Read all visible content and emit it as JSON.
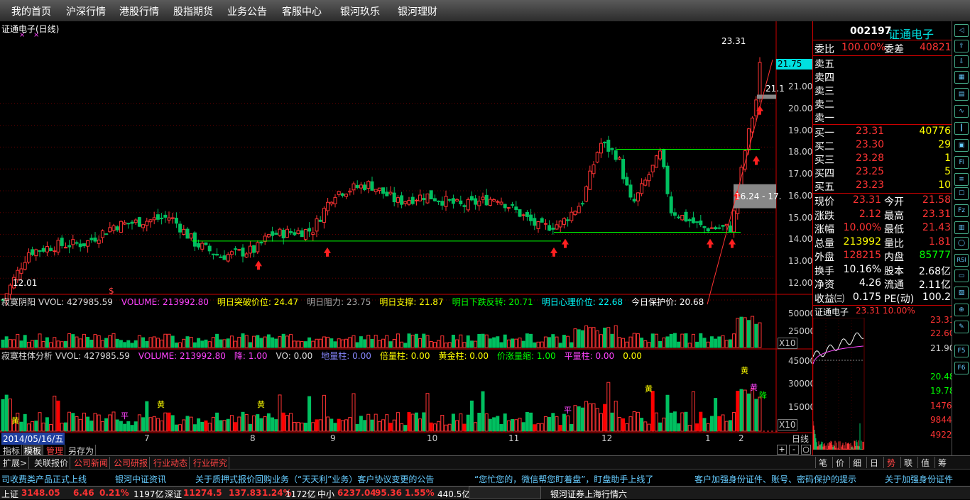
{
  "menu": [
    "我的首页",
    "沪深行情",
    "港股行情",
    "股指期货",
    "业务公告",
    "客服中心",
    "银河玖乐",
    "银河理财"
  ],
  "chart": {
    "title": "证通电子(日线)",
    "max_label": "23.31",
    "min_label": "12.01",
    "price_tag": "21.75",
    "edge_label": "21.1",
    "box_label": "16.24 - 17.",
    "price_ticks": [
      "21.00",
      "20.00",
      "19.00",
      "18.00",
      "17.00",
      "16.00",
      "15.00",
      "14.00",
      "13.00",
      "12.00"
    ],
    "date_box": "2014/05/16/五",
    "months": [
      "7",
      "8",
      "9",
      "10",
      "11",
      "12",
      "1",
      "2"
    ],
    "vol_ticks": [
      "50000",
      "25000",
      "X10"
    ],
    "vol2_ticks": [
      "45000",
      "30000",
      "15000",
      "X10"
    ],
    "money_mark": "$",
    "ind1": [
      {
        "t": "寂寞阴阳 VVOL: 427985.59",
        "c": "#dddddd"
      },
      {
        "t": "VOLUME: 213992.80",
        "c": "#ff44ff"
      },
      {
        "t": "明日突破价位: 24.47",
        "c": "#ffff00"
      },
      {
        "t": "明日阻力: 23.75",
        "c": "#aaaaaa"
      },
      {
        "t": "明日支撑: 21.87",
        "c": "#ffff00"
      },
      {
        "t": "明日下跌反转: 20.71",
        "c": "#00ff00"
      },
      {
        "t": "明日心理价位: 22.68",
        "c": "#00ffff"
      },
      {
        "t": "今日保护价: 20.68",
        "c": "#ffffff"
      }
    ],
    "ind2": [
      {
        "t": "寂寞柱体分析 VVOL: 427985.59",
        "c": "#dddddd"
      },
      {
        "t": "VOLUME: 213992.80",
        "c": "#ff44ff"
      },
      {
        "t": "降: 1.00",
        "c": "#ff44ff"
      },
      {
        "t": "VO: 0.00",
        "c": "#dddddd"
      },
      {
        "t": "地量柱: 0.00",
        "c": "#8888ff"
      },
      {
        "t": "倍量柱: 0.00",
        "c": "#ffff00"
      },
      {
        "t": "黄金柱: 0.00",
        "c": "#ffff00"
      },
      {
        "t": "价涨量缩: 1.00",
        "c": "#00ff00"
      },
      {
        "t": "平量柱: 0.00",
        "c": "#ff44ff"
      },
      {
        "t": "0.00",
        "c": "#ffff00"
      }
    ],
    "vol_labels": [
      "黄",
      "平",
      "黄",
      "黄",
      "平",
      "黄",
      "黄",
      "黄",
      "降"
    ]
  },
  "subtabs": [
    "指标",
    "模板",
    "管理",
    "另存为"
  ],
  "extabs": [
    "扩展>",
    "关联报价",
    "公司新闻",
    "公司研报",
    "行业动态",
    "行业研究"
  ],
  "quote": {
    "code": "002197",
    "name": "证通电子",
    "wb_label": "委比",
    "wb": "100.00%",
    "wc_label": "委差",
    "wc": "40821",
    "sell": [
      "卖五",
      "卖四",
      "卖三",
      "卖二",
      "卖一"
    ],
    "buy": [
      {
        "l": "买一",
        "p": "23.31",
        "v": "40776"
      },
      {
        "l": "买二",
        "p": "23.30",
        "v": "29"
      },
      {
        "l": "买三",
        "p": "23.28",
        "v": "1"
      },
      {
        "l": "买四",
        "p": "23.25",
        "v": "5"
      },
      {
        "l": "买五",
        "p": "23.23",
        "v": "10"
      }
    ],
    "stats": [
      {
        "l1": "现价",
        "v1": "23.31",
        "c1": "#ff3333",
        "l2": "今开",
        "v2": "21.58",
        "c2": "#ff3333"
      },
      {
        "l1": "涨跌",
        "v1": "2.12",
        "c1": "#ff3333",
        "l2": "最高",
        "v2": "23.31",
        "c2": "#ff3333"
      },
      {
        "l1": "涨幅",
        "v1": "10.00%",
        "c1": "#ff3333",
        "l2": "最低",
        "v2": "21.43",
        "c2": "#ff3333"
      },
      {
        "l1": "总量",
        "v1": "213992",
        "c1": "#ffff00",
        "l2": "量比",
        "v2": "1.81",
        "c2": "#ff3333"
      },
      {
        "l1": "外盘",
        "v1": "128215",
        "c1": "#ff3333",
        "l2": "内盘",
        "v2": "85777",
        "c2": "#00ff00"
      },
      {
        "l1": "换手",
        "v1": "10.16%",
        "c1": "#ffffff",
        "l2": "股本",
        "v2": "2.68亿",
        "c2": "#ffffff"
      },
      {
        "l1": "净资",
        "v1": "4.26",
        "c1": "#ffffff",
        "l2": "流通",
        "v2": "2.11亿",
        "c2": "#ffffff"
      },
      {
        "l1": "收益㈢",
        "v1": "0.175",
        "c1": "#ffffff",
        "l2": "PE(动)",
        "v2": "100.2",
        "c2": "#ffffff"
      }
    ],
    "mini_title": "证通电子",
    "mini_price": "23.31",
    "mini_pct": "10.00%",
    "mini_ticks": [
      "23.31",
      "22.60",
      "21.90",
      "20.48",
      "19.78",
      "14766",
      "9844",
      "4922"
    ],
    "tick_label": "日线",
    "bottom_tabs": [
      "笔",
      "价",
      "细",
      "日",
      "势",
      "联",
      "值",
      "筹"
    ]
  },
  "tools": [
    "Fi",
    "Fz",
    "RSI",
    "F5",
    "F6"
  ],
  "news": [
    "司收费类产品正式上线",
    "银河中证资讯",
    "关于质押式报价回购业务（“天天利”业务）客户协议变更的公告",
    "“您忙您的，微信帮您盯着盘”，盯盘助手上线了",
    "客户加强身份证件、账号、密码保护的提示",
    "关于加强身份证件"
  ],
  "status": {
    "sh_label": "上证",
    "sh": "3148.05",
    "sh_chg": "6.46",
    "sh_pct": "0.21%",
    "sh_amt": "1197亿",
    "sz_label": "深证",
    "sz": "11274.5",
    "sz_chg": "137.83",
    "sz_pct": "1.24%",
    "sz_amt": "1172亿",
    "zx_label": "中小",
    "zx": "6237.04",
    "zx_chg": "95.36",
    "zx_pct": "1.55%",
    "zx_amt": "440.5亿",
    "server": "银河证券上海行情六"
  }
}
